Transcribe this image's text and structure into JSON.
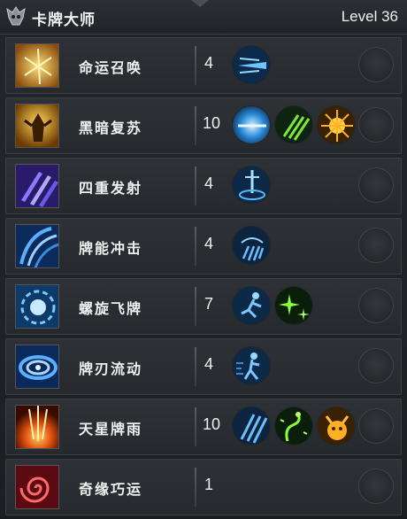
{
  "header": {
    "title": "卡牌大师",
    "level": "Level 36",
    "emblem": "demon-skull-emblem"
  },
  "skills": [
    {
      "name": "命运召唤",
      "rank": "4",
      "icon": "golden-light-icon",
      "modifiers": [
        "ice-dash-icon"
      ]
    },
    {
      "name": "黑暗复苏",
      "rank": "10",
      "icon": "dark-figure-icon",
      "modifiers": [
        "blue-orb-icon",
        "green-claw-icon",
        "golden-burst-icon"
      ]
    },
    {
      "name": "四重发射",
      "rank": "4",
      "icon": "purple-blades-icon",
      "modifiers": [
        "blade-strike-icon"
      ]
    },
    {
      "name": "牌能冲击",
      "rank": "4",
      "icon": "blue-wave-icon",
      "modifiers": [
        "swirl-hand-icon"
      ]
    },
    {
      "name": "螺旋飞牌",
      "rank": "7",
      "icon": "spinning-cards-icon",
      "modifiers": [
        "running-figure-icon",
        "green-sparkle-icon"
      ]
    },
    {
      "name": "牌刃流动",
      "rank": "4",
      "icon": "blue-vortex-icon",
      "modifiers": [
        "dash-figure-icon"
      ]
    },
    {
      "name": "天星牌雨",
      "rank": "10",
      "icon": "fire-rain-icon",
      "modifiers": [
        "blue-claw-icon",
        "green-serpent-icon",
        "golden-beast-icon"
      ]
    },
    {
      "name": "奇缘巧运",
      "rank": "1",
      "icon": "red-spiral-icon",
      "modifiers": []
    }
  ]
}
